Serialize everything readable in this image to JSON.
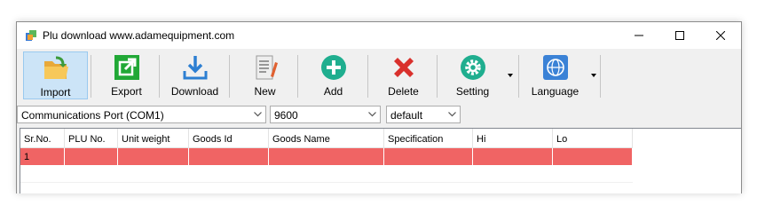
{
  "window": {
    "title": "Plu download www.adamequipment.com"
  },
  "toolbar": {
    "import": "Import",
    "export": "Export",
    "download": "Download",
    "new": "New",
    "add": "Add",
    "delete": "Delete",
    "setting": "Setting",
    "language": "Language"
  },
  "comm": {
    "port": "Communications Port (COM1)",
    "baud": "9600",
    "profile": "default"
  },
  "table": {
    "headers": [
      "Sr.No.",
      "PLU No.",
      "Unit weight",
      "Goods Id",
      "Goods Name",
      "Specification",
      "Hi",
      "Lo"
    ],
    "rows": [
      [
        "1",
        "",
        "",
        "",
        "",
        "",
        "",
        ""
      ]
    ]
  },
  "colors": {
    "selected_row": "#f06464",
    "accent": "#cce4f7"
  }
}
